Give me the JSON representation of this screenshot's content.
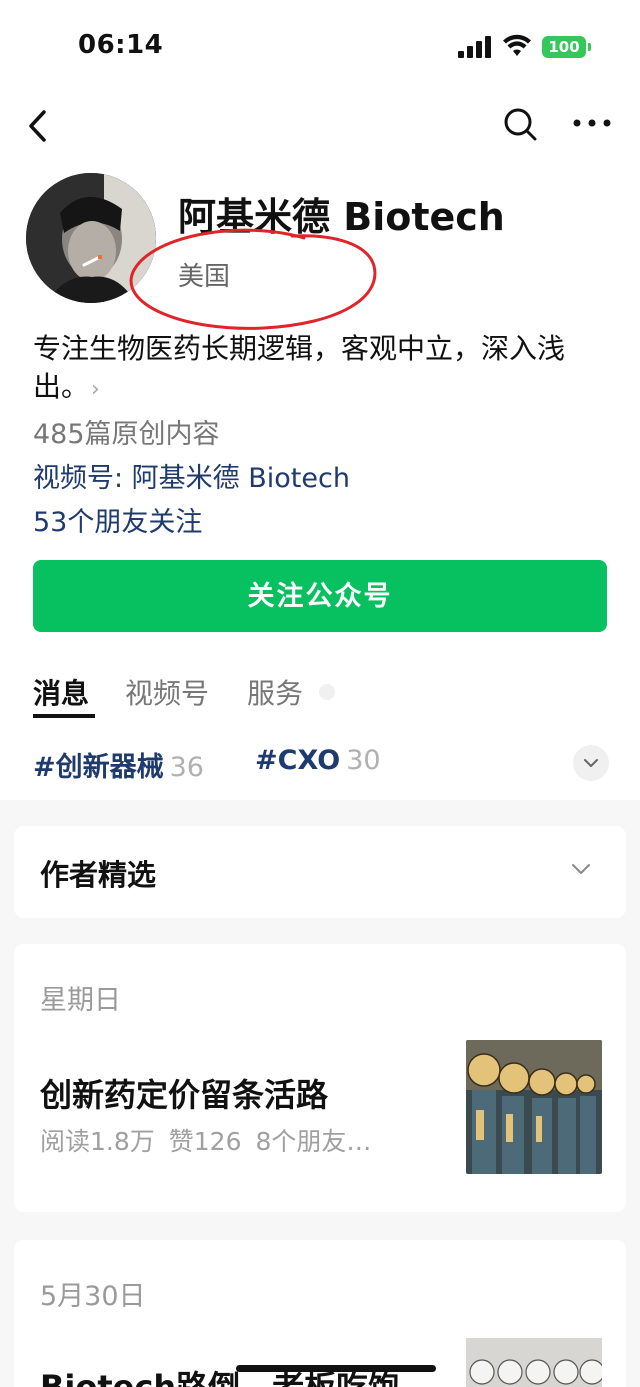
{
  "status_bar": {
    "time": "06:14",
    "battery": "100"
  },
  "nav": {
    "back": "back",
    "search": "search",
    "more": "more"
  },
  "profile": {
    "name": "阿基米德 Biotech",
    "region": "美国",
    "description": "专注生物医药长期逻辑，客观中立，深入浅出。",
    "original_count": "485篇原创内容",
    "video_channel": "视频号: 阿基米德 Biotech",
    "friends_following": "53个朋友关注",
    "follow_button": "关注公众号"
  },
  "tabs": [
    {
      "label": "消息"
    },
    {
      "label": "视频号"
    },
    {
      "label": "服务"
    }
  ],
  "tags": [
    {
      "label": "#创新器械",
      "count": "36"
    },
    {
      "label": "#CXO",
      "count": "30"
    }
  ],
  "author_picks": {
    "title": "作者精选"
  },
  "articles": [
    {
      "date": "星期日",
      "title": "创新药定价留条活路",
      "reads": "阅读1.8万",
      "likes": "赞126",
      "friends": "8个朋友…"
    },
    {
      "date": "5月30日",
      "title": "Biotech路倒，老板吃饱"
    }
  ],
  "colors": {
    "accent_green": "#07c160",
    "link_blue": "#1f3a6e",
    "annotation_red": "#e0252a"
  }
}
